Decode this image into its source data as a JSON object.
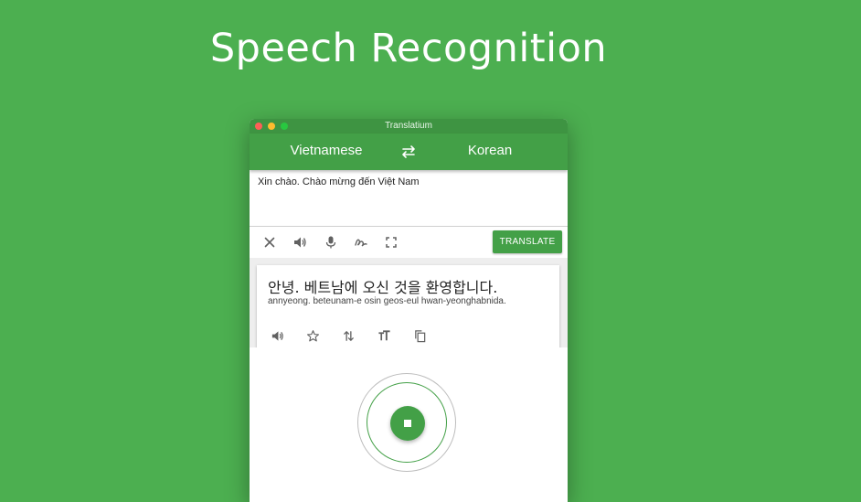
{
  "headline": "Speech Recognition",
  "window": {
    "title": "Translatium"
  },
  "languages": {
    "source": "Vietnamese",
    "target": "Korean",
    "swap_icon": "swap-arrows-icon"
  },
  "input": {
    "text": "Xin chào. Chào mừng đến Việt Nam"
  },
  "toolbar": {
    "icons": [
      "close-icon",
      "speaker-icon",
      "microphone-icon",
      "handwriting-icon",
      "fullscreen-icon"
    ],
    "translate_label": "TRANSLATE"
  },
  "result": {
    "text": "안녕. 베트남에 오신 것을 환영합니다.",
    "romanization": "annyeong. beteunam-e osin geos-eul hwan-yeonghabnida.",
    "icons": [
      "speaker-icon",
      "star-icon",
      "swap-vertical-icon",
      "text-size-icon",
      "copy-icon"
    ]
  },
  "speech": {
    "state": "listening",
    "button_icon": "stop-icon"
  },
  "colors": {
    "background": "#4caf50",
    "accent": "#43a047",
    "titlebar": "#3e9442"
  }
}
